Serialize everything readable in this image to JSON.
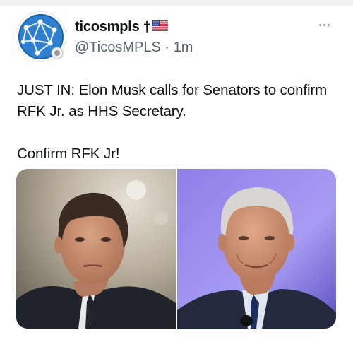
{
  "post": {
    "display_name": "ticosmpls",
    "name_suffix": "†",
    "handle": "@TicosMPLS",
    "separator": "·",
    "time": "1m",
    "text_line1": "JUST IN: Elon Musk calls for Senators to confirm RFK Jr. as HHS Secretary.",
    "text_line2": "Confirm RFK Jr!"
  },
  "icons": {
    "avatar": "globe-network-logo",
    "flag": "us-flag-icon",
    "more": "more-horizontal-icon"
  },
  "colors": {
    "handle": "#536471",
    "avatar_blue": "#2f7fd1",
    "photo_left_bg": "#c2b7a6",
    "photo_right_bg": "#9b8ff0"
  },
  "media": {
    "photos": [
      {
        "subject": "Elon Musk portrait"
      },
      {
        "subject": "RFK Jr. portrait"
      }
    ]
  }
}
